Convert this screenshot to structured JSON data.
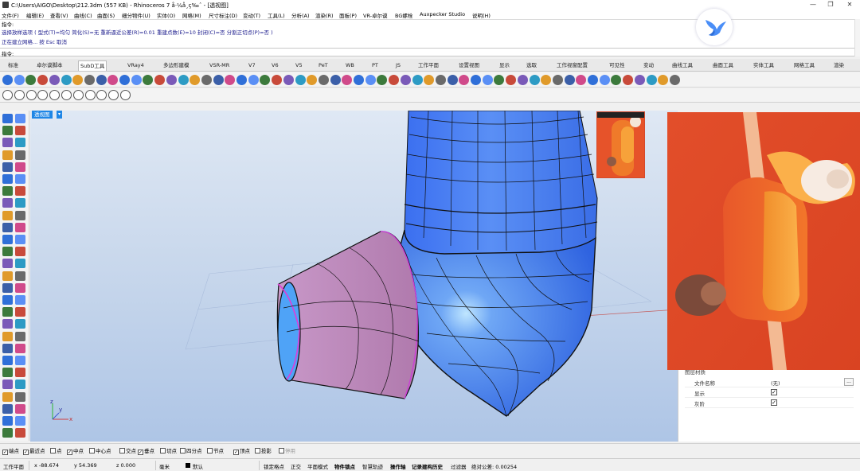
{
  "window": {
    "title": "C:\\Users\\AIGO\\Desktop\\212.3dm (557 KB) - Rhinoceros 7 å·¼å¸ç‰ˆ - [透视图]",
    "controls": [
      "—",
      "❐",
      "✕"
    ]
  },
  "menu": [
    "文件(F)",
    "编辑(E)",
    "查看(V)",
    "曲线(C)",
    "曲面(S)",
    "细分物件(U)",
    "实体(O)",
    "网格(M)",
    "尺寸标注(D)",
    "变动(T)",
    "工具(L)",
    "分析(A)",
    "渲染(R)",
    "面板(P)",
    "VR-卓尔谟",
    "BG螺栓",
    "Auxpecker Studio",
    "说明(H)"
  ],
  "command_history": [
    "指令:",
    "选择放样选项 ( 型式(T)=均匀  简化(S)=无  重新逼近公差(R)=0.01  重建点数(E)=10  封闭(C)=否  分割正切点(P)=否 )",
    "正在建立网格... 按 Esc 取消"
  ],
  "command_prompt": "指令:",
  "tabs": [
    "标准",
    "卓尔谟脚本",
    "SubD工具",
    "VRay4",
    "多边形建模",
    "VSR-MR",
    "V7",
    "V6",
    "V5",
    "PeT",
    "WB",
    "PT",
    "JS",
    "工作平面",
    "设置视图",
    "显示",
    "选取",
    "工作视窗配置",
    "可见性",
    "变动",
    "曲线工具",
    "曲面工具",
    "实体工具",
    "网格工具",
    "渲染"
  ],
  "active_tab": "SubD工具",
  "viewport": {
    "label": "透视图",
    "axis_x": "x",
    "axis_y": "y",
    "axis_z": "z"
  },
  "properties": {
    "header": "图层材质",
    "rows": [
      {
        "key": "文件名称",
        "value": "(无)",
        "has_more": true
      },
      {
        "key": "显示",
        "checked": true
      },
      {
        "key": "灰阶",
        "checked": true
      }
    ]
  },
  "osnaps": [
    {
      "label": "端点",
      "checked": true
    },
    {
      "label": "最近点",
      "checked": true
    },
    {
      "label": "点",
      "checked": false
    },
    {
      "label": "中点",
      "checked": true
    },
    {
      "label": "中心点",
      "checked": false
    },
    {
      "label": "交点",
      "checked": false
    },
    {
      "label": "垂点",
      "checked": true
    },
    {
      "label": "切点",
      "checked": false
    },
    {
      "label": "四分点",
      "checked": false
    },
    {
      "label": "节点",
      "checked": false
    },
    {
      "label": "顶点",
      "checked": true
    },
    {
      "label": "投影",
      "checked": false
    },
    {
      "label": "停用",
      "checked": false,
      "disabled": true
    }
  ],
  "status": {
    "plane": "工作平面",
    "x": "x -88.674",
    "y": "y 54.369",
    "z": "z 0.000",
    "units": "毫米",
    "layer": "默认",
    "toggles": [
      "锁定格点",
      "正交",
      "平面模式",
      "物件锁点",
      "智慧轨迹",
      "操作轴",
      "记录建构历史",
      "过滤器"
    ],
    "tolerance": "绝对公差: 0.00254"
  },
  "colors": {
    "model_blue": "#3f7df0",
    "model_pink": "#c48cc0",
    "viewport_label": "#1e86e6",
    "reference_orange": "#e8552c"
  },
  "icons": [
    "save-icon",
    "open-icon",
    "sphere-icon",
    "cylinder-icon",
    "subd-box-icon",
    "crease-icon",
    "select-icon",
    "point-icon",
    "curve-icon",
    "circle-icon",
    "arc-icon",
    "rectangle-icon",
    "polygon-icon",
    "fillet-icon",
    "extrude-icon",
    "loft-icon",
    "boolean-icon",
    "move-icon",
    "rotate-icon",
    "scale-icon",
    "mirror-icon",
    "array-icon",
    "render-icon",
    "material-icon",
    "light-icon",
    "snap-icon",
    "grid-icon",
    "layer-icon",
    "lock-icon",
    "hide-icon"
  ]
}
